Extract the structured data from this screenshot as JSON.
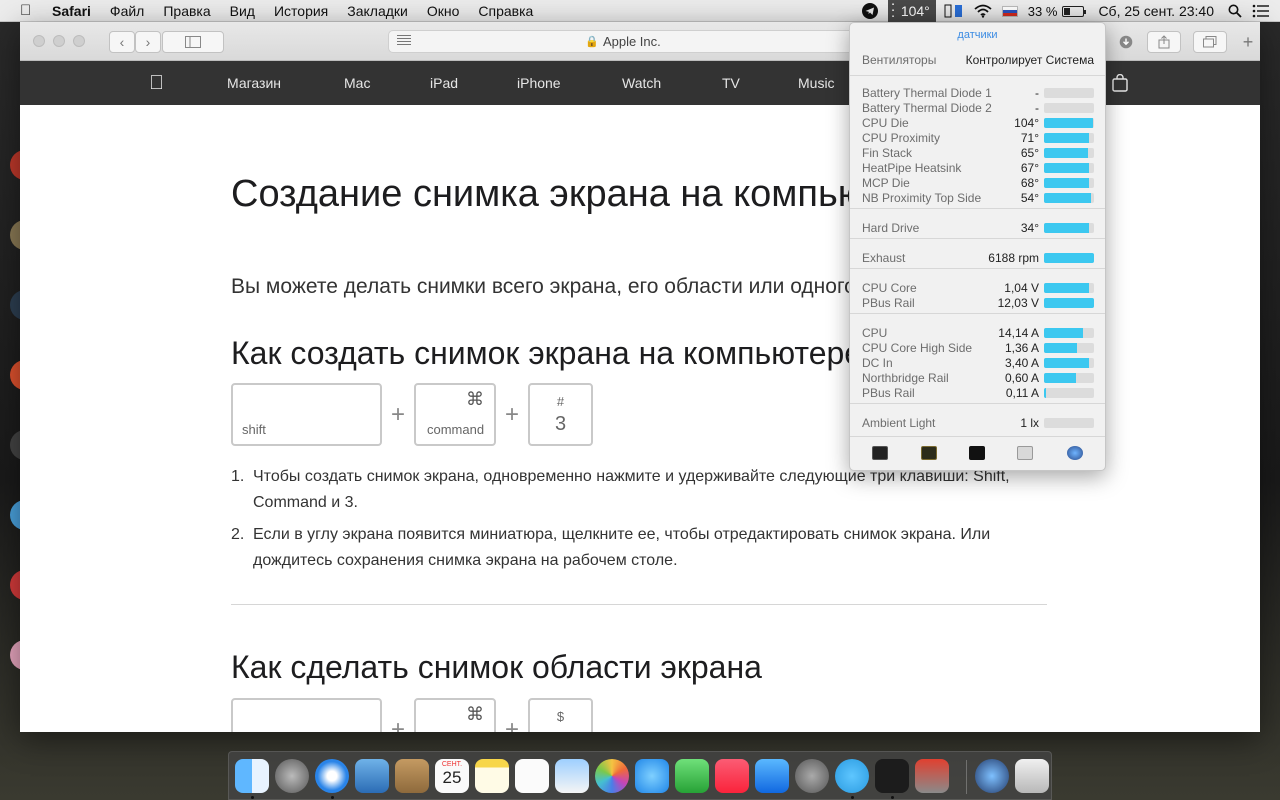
{
  "menubar": {
    "app_name": "Safari",
    "items": [
      "Файл",
      "Правка",
      "Вид",
      "История",
      "Закладки",
      "Окно",
      "Справка"
    ],
    "temp_label": "104°",
    "battery_percent": "33 %",
    "battery_level": 0.33,
    "clock": "Сб, 25 сент.  23:40"
  },
  "browser": {
    "address": "Apple Inc.",
    "nav_items": [
      "Магазин",
      "Mac",
      "iPad",
      "iPhone",
      "Watch",
      "TV",
      "Music"
    ]
  },
  "article": {
    "title": "Создание снимка экрана на компьютере Mac",
    "lede": "Вы можете делать снимки всего экрана, его области или одного окна.",
    "section1_title": "Как создать снимок экрана на компьютере Mac",
    "keys1": {
      "shift": "shift",
      "command_symbol": "⌘",
      "command": "command",
      "hash": "#",
      "three": "3",
      "plus": "+"
    },
    "steps": [
      {
        "num": "1.",
        "text": "Чтобы создать снимок экрана, одновременно нажмите и удерживайте следующие три клавиши: Shift, Command и 3."
      },
      {
        "num": "2.",
        "text": "Если в углу экрана появится миниатюра, щелкните ее, чтобы отредактировать снимок экрана. Или дождитесь сохранения снимка экрана на рабочем столе."
      }
    ],
    "section2_title": "Как сделать снимок области экрана",
    "keys2": {
      "command_symbol": "⌘",
      "dollar": "$",
      "plus": "+"
    }
  },
  "sensors": {
    "title": "датчики",
    "fans_label": "Вентиляторы",
    "fans_value": "Контролирует Система",
    "groups": [
      [
        {
          "label": "Battery Thermal Diode 1",
          "value": "-",
          "level": 0
        },
        {
          "label": "Battery Thermal Diode 2",
          "value": "-",
          "level": 0
        },
        {
          "label": "CPU Die",
          "value": "104°",
          "level": 0.98
        },
        {
          "label": "CPU Proximity",
          "value": "71°",
          "level": 0.9
        },
        {
          "label": "Fin Stack",
          "value": "65°",
          "level": 0.88
        },
        {
          "label": "HeatPipe Heatsink",
          "value": "67°",
          "level": 0.9
        },
        {
          "label": "MCP Die",
          "value": "68°",
          "level": 0.9
        },
        {
          "label": "NB Proximity Top Side",
          "value": "54°",
          "level": 0.94
        }
      ],
      [
        {
          "label": "Hard Drive",
          "value": "34°",
          "level": 0.9
        }
      ],
      [
        {
          "label": "Exhaust",
          "value": "6188 rpm",
          "level": 1.0
        }
      ],
      [
        {
          "label": "CPU Core",
          "value": "1,04 V",
          "level": 0.9
        },
        {
          "label": "PBus Rail",
          "value": "12,03 V",
          "level": 1.0
        }
      ],
      [
        {
          "label": "CPU",
          "value": "14,14 A",
          "level": 0.78
        },
        {
          "label": "CPU Core High Side",
          "value": "1,36 A",
          "level": 0.65
        },
        {
          "label": "DC In",
          "value": "3,40 A",
          "level": 0.9
        },
        {
          "label": "Northbridge Rail",
          "value": "0,60 A",
          "level": 0.64
        },
        {
          "label": "PBus Rail",
          "value": "0,11 A",
          "level": 0.03
        }
      ],
      [
        {
          "label": "Ambient Light",
          "value": "1 lx",
          "level": 0
        }
      ]
    ]
  },
  "dock": {
    "icons": [
      "finder-icon",
      "launchpad-icon",
      "safari-icon",
      "mail-icon",
      "contacts-icon",
      "calendar-icon",
      "notes-icon",
      "reminders-icon",
      "preview-icon",
      "photos-icon",
      "messages-icon",
      "facetime-icon",
      "music-icon",
      "app-store-icon",
      "system-preferences-icon",
      "telegram-icon",
      "terminal-icon",
      "utility-icon",
      "istat-icon",
      "trash-icon"
    ],
    "calendar_day": "25",
    "calendar_month": "СЕНТ."
  }
}
